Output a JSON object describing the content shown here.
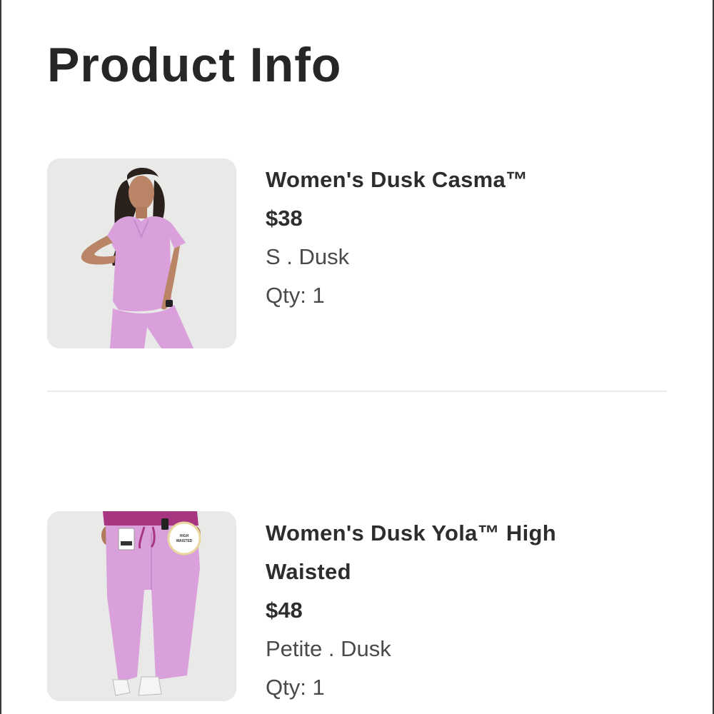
{
  "page": {
    "title": "Product Info"
  },
  "products": [
    {
      "name": "Women's Dusk Casma™",
      "price": "$38",
      "variant": "S . Dusk",
      "quantity": "Qty: 1",
      "image_icon": "scrub-top-photo",
      "image_bg_color": "#e9e9e7",
      "garment_color": "#d9a0dc"
    },
    {
      "name_line1": "Women's Dusk Yola™ High",
      "name_line2": "Waisted",
      "price": "$48",
      "variant": "Petite . Dusk",
      "quantity": "Qty: 1",
      "image_icon": "scrub-pants-photo",
      "image_badge": "HIGH WAISTED",
      "image_bg_color": "#e9e9e7",
      "garment_color": "#d9a0dc"
    }
  ]
}
